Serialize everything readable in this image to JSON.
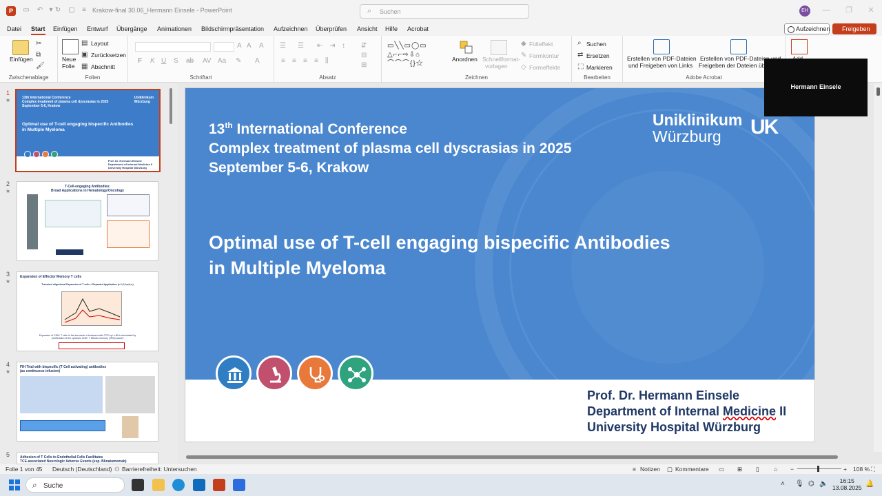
{
  "titlebar": {
    "app_icon": "P",
    "doc_title": "Krakow-final 30.06_Hermann Einsele  -  PowerPoint",
    "search_placeholder": "Suchen",
    "avatar_initials": "EH"
  },
  "menu": {
    "tabs": [
      "Datei",
      "Start",
      "Einfügen",
      "Entwurf",
      "Übergänge",
      "Animationen",
      "Bildschirmpräsentation",
      "Aufzeichnen",
      "Überprüfen",
      "Ansicht",
      "Hilfe",
      "Acrobat"
    ],
    "active": "Start",
    "record_label": "Aufzeichnen",
    "share_label": "Freigeben"
  },
  "ribbon": {
    "clipboard": {
      "paste_label": "Einfügen",
      "group_label": "Zwischenablage"
    },
    "slides": {
      "new_slide_label_1": "Neue",
      "new_slide_label_2": "Folie",
      "layout": "Layout",
      "reset": "Zurücksetzen",
      "section": "Abschnitt",
      "group_label": "Folien"
    },
    "font": {
      "group_label": "Schriftart"
    },
    "paragraph": {
      "group_label": "Absatz"
    },
    "drawing": {
      "arrange_label": "Anordnen",
      "quick_styles_1": "Schnellformat-",
      "quick_styles_2": "vorlagen",
      "fill": "Fülleffekt",
      "outline": "Formkontur",
      "effects": "Formeffekte",
      "group_label": "Zeichnen"
    },
    "editing": {
      "find": "Suchen",
      "replace": "Ersetzen",
      "select": "Markieren",
      "group_label": "Bearbeiten"
    },
    "acrobat": {
      "pdf1_line1": "Erstellen von PDF-Dateien",
      "pdf1_line2": "und Freigeben von Links",
      "pdf2_line1": "Erstellen von PDF-Dateien und",
      "pdf2_line2": "Freigeben der Dateien über O",
      "group_label": "Adobe Acrobat"
    },
    "addin_label": "Add-"
  },
  "thumbnails": {
    "numbers": [
      "1",
      "2",
      "3",
      "4",
      "5"
    ],
    "t1": {
      "h1": "13th International Conference",
      "h2": "Complex treatment of plasma cell dyscrasias in 2025",
      "h3": "September 5-6, Krakow",
      "title1": "Optimal use of T-cell engaging bispecific Antibodies",
      "title2": "in Multiple Myeloma",
      "logo1": "Uniklinikum",
      "logo2": "Würzburg",
      "f1": "Prof. Dr. Hermann Einsele",
      "f2": "Department of Internal Medicine II",
      "f3": "University Hospital Würzburg"
    },
    "t2": {
      "title1": "T-Cell-engaging Antibodies:",
      "title2": "Broad Applications in Hematology/Oncology"
    },
    "t3": {
      "title": "Expansion of Effector Memory T cells",
      "subtitle": "Transient oligoclonal Expansion of T cells + Repeated Application (e.1,2,3,a,b,c.)",
      "caption1": "Expansion of CD8+ T cells in the last week of treatment with TCE by i.v.Bli is dominated by",
      "caption2": "proliferation of the cytotoxic CD8+ T effector memory (TEM) subset"
    },
    "t4": {
      "title1": "FIH Trial with bispecific (T Cell activating) antibodies",
      "title2": "(as continuous infusion)"
    },
    "t5": {
      "title1": "Adhesion of T Cells to Endothelial Cells Facilitates",
      "title2": "TCE-associated Neurologic Adverse Events (esp. Blinatumomab)"
    }
  },
  "slide": {
    "conf_line1_num": "13",
    "conf_line1_sup": "th",
    "conf_line1_rest": " International Conference",
    "conf_line2": "Complex treatment of plasma cell dyscrasias in 2025",
    "conf_line3": "September 5-6, Krakow",
    "title_line1": "Optimal use of T-cell engaging bispecific Antibodies",
    "title_line2": "in Multiple Myeloma",
    "logo_line1": "Uniklinikum",
    "logo_line2": "Würzburg",
    "logo_mark": "UK",
    "presenter": "Prof. Dr. Hermann Einsele",
    "dept_pre": "Department of Internal ",
    "dept_word": "Medicine",
    "dept_post": " II",
    "hospital": "University Hospital Würzburg",
    "circle_colors": [
      "#2f7ec4",
      "#c0506d",
      "#e8793a",
      "#2fa27e"
    ]
  },
  "video": {
    "name": "Hermann Einsele"
  },
  "statusbar": {
    "slide_info": "Folie 1 von 45",
    "language": "Deutsch (Deutschland)",
    "accessibility": "Barrierefreiheit: Untersuchen",
    "notes": "Notizen",
    "comments": "Kommentare",
    "zoom": "108 %"
  },
  "taskbar": {
    "search_label": "Suche",
    "time": "16:15",
    "date": "13.08.2025"
  }
}
